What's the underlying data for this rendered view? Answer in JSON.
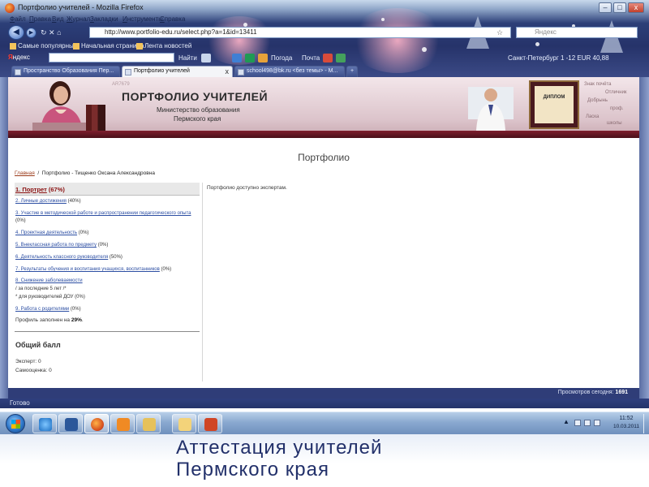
{
  "window": {
    "title": "Портфолио учителей - Mozilla Firefox",
    "minimize": "–",
    "maximize": "□",
    "close": "x"
  },
  "menu": [
    "Файл",
    "Правка",
    "Вид",
    "Журнал",
    "Закладки",
    "Инструменты",
    "Справка"
  ],
  "nav": {
    "back": "◀",
    "forward": "▶",
    "url": "http://www.portfolio-edu.ru/select.php?a=1&id=13411",
    "search_placeholder": "Яндекс"
  },
  "bookmarks": [
    "Самые популярные",
    "Начальная страница",
    "Лента новостей"
  ],
  "yandex_bar": {
    "logo": "Я",
    "label": "ндекс",
    "find": "Найти",
    "tools": [
      "Погода",
      "Почта"
    ],
    "right_text": "Санкт-Петербург  1   -12   EUR 40,88"
  },
  "tabs": [
    {
      "label": "Пространство Образования Пер...",
      "active": false
    },
    {
      "label": "Портфолио учителей",
      "active": true,
      "close": "x"
    },
    {
      "label": "school498@bk.ru <без темы> - M...",
      "active": false
    }
  ],
  "banner": {
    "title": "ПОРТФОЛИО УЧИТЕЛЕЙ",
    "subtitle_line1": "Министерство образования",
    "subtitle_line2": "Пермского края",
    "diploma_text": "ДИПЛОМ",
    "watermark": "AR7679",
    "word_cloud": [
      "Знак почёта",
      "Отличник",
      "Добрынь",
      "проф.",
      "Ласка",
      "школы"
    ]
  },
  "page": {
    "heading": "Портфолио",
    "breadcrumb_home": "Главная",
    "breadcrumb_rest": "Портфолио - Тищенко Оксана Александровна",
    "right_text": "Портфолио доступно экспертам.",
    "menu": [
      {
        "link": "1. Портрет",
        "suffix": " (67%)",
        "selected": true
      },
      {
        "link": "2. Личные достижения",
        "suffix": " (40%)"
      },
      {
        "link": "3. Участие в методической работе и распространении педагогического опыта",
        "suffix": "",
        "extra": "(0%)"
      },
      {
        "link": "4. Проектная деятельность",
        "suffix": " (0%)"
      },
      {
        "link": "5. Внеклассная работа по предмету",
        "suffix": " (0%)"
      },
      {
        "link": "6. Деятельность классного руководителя",
        "suffix": " (50%)"
      },
      {
        "link": "7. Результаты обучения и воспитания учащихся, воспитанников",
        "suffix": " (0%)"
      },
      {
        "link": "8. Снижение заболеваемости",
        "suffix": "",
        "extra": "/ за последние 5 лет /*",
        "extra2": "* для руководителей ДОУ (0%)"
      },
      {
        "link": "9. Работа с родителями",
        "suffix": " (0%)"
      }
    ],
    "progress_prefix": "Профиль заполнен на ",
    "progress_value": "29%",
    "progress_suffix": ".",
    "score_heading": "Общий балл",
    "expert_line": "Эксперт: 0",
    "self_line": "Самооценка: 0",
    "views_prefix": "Просмотров сегодня: ",
    "views_value": "1691"
  },
  "status": "Готово",
  "taskbar": {
    "time": "11:52",
    "date": "10.03.2011"
  },
  "caption": {
    "line1": "Аттестация учителей",
    "line2": "Пермского края"
  },
  "colors": {
    "taskbar": "#8aa9d0",
    "link": "#2d4fa3",
    "selected_link": "#8b1111",
    "banner_strip": "#7e1f2e",
    "caption": "#22306a"
  }
}
